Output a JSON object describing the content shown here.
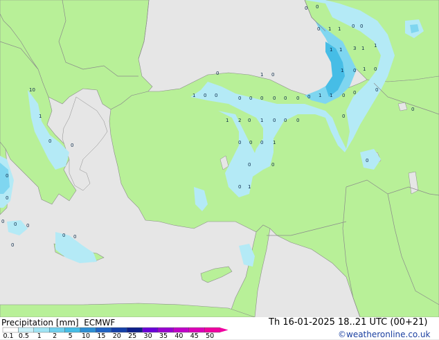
{
  "legend": {
    "title": "Precipitation [mm]",
    "model": "ECMWF",
    "valid_time": "Th 16-01-2025 18..21 UTC (00+21)",
    "credit": "©weatheronline.co.uk",
    "ticks": [
      "0.1",
      "0.5",
      "1",
      "2",
      "5",
      "10",
      "15",
      "20",
      "25",
      "30",
      "35",
      "40",
      "45",
      "50"
    ],
    "colors": [
      "#ffffff",
      "#c8f0f8",
      "#a0e4f4",
      "#6fd0ee",
      "#46bde6",
      "#2e8fd4",
      "#1f63c4",
      "#1540a8",
      "#0d1f8a",
      "#6a00d8",
      "#9800d0",
      "#c000c8",
      "#dc00b8",
      "#f000a0"
    ]
  },
  "map": {
    "sea_color": "#e6e6e6",
    "land_color": "#b8f098",
    "border_color": "#8a8a8a",
    "precip_light": "#b4eaf6",
    "precip_mid": "#7fd6f0",
    "precip_heavy": "#46bde6",
    "point_values": [
      "0",
      "0",
      "0",
      "1",
      "1",
      "0",
      "0",
      "1",
      "1",
      "3",
      "1",
      "1",
      "1",
      "0",
      "1",
      "0",
      "1",
      "0",
      "0",
      "0",
      "1",
      "0",
      "0",
      "1",
      "0",
      "0",
      "0",
      "0",
      "0",
      "0",
      "0",
      "0",
      "0",
      "1",
      "1",
      "2",
      "0",
      "1",
      "0",
      "0",
      "0",
      "0",
      "0",
      "0",
      "0",
      "1",
      "0",
      "0",
      "0",
      "1",
      "0",
      "0",
      "10",
      "1",
      "0",
      "0",
      "0",
      "0",
      "0",
      "0",
      "0",
      "0",
      "0",
      "0"
    ]
  }
}
